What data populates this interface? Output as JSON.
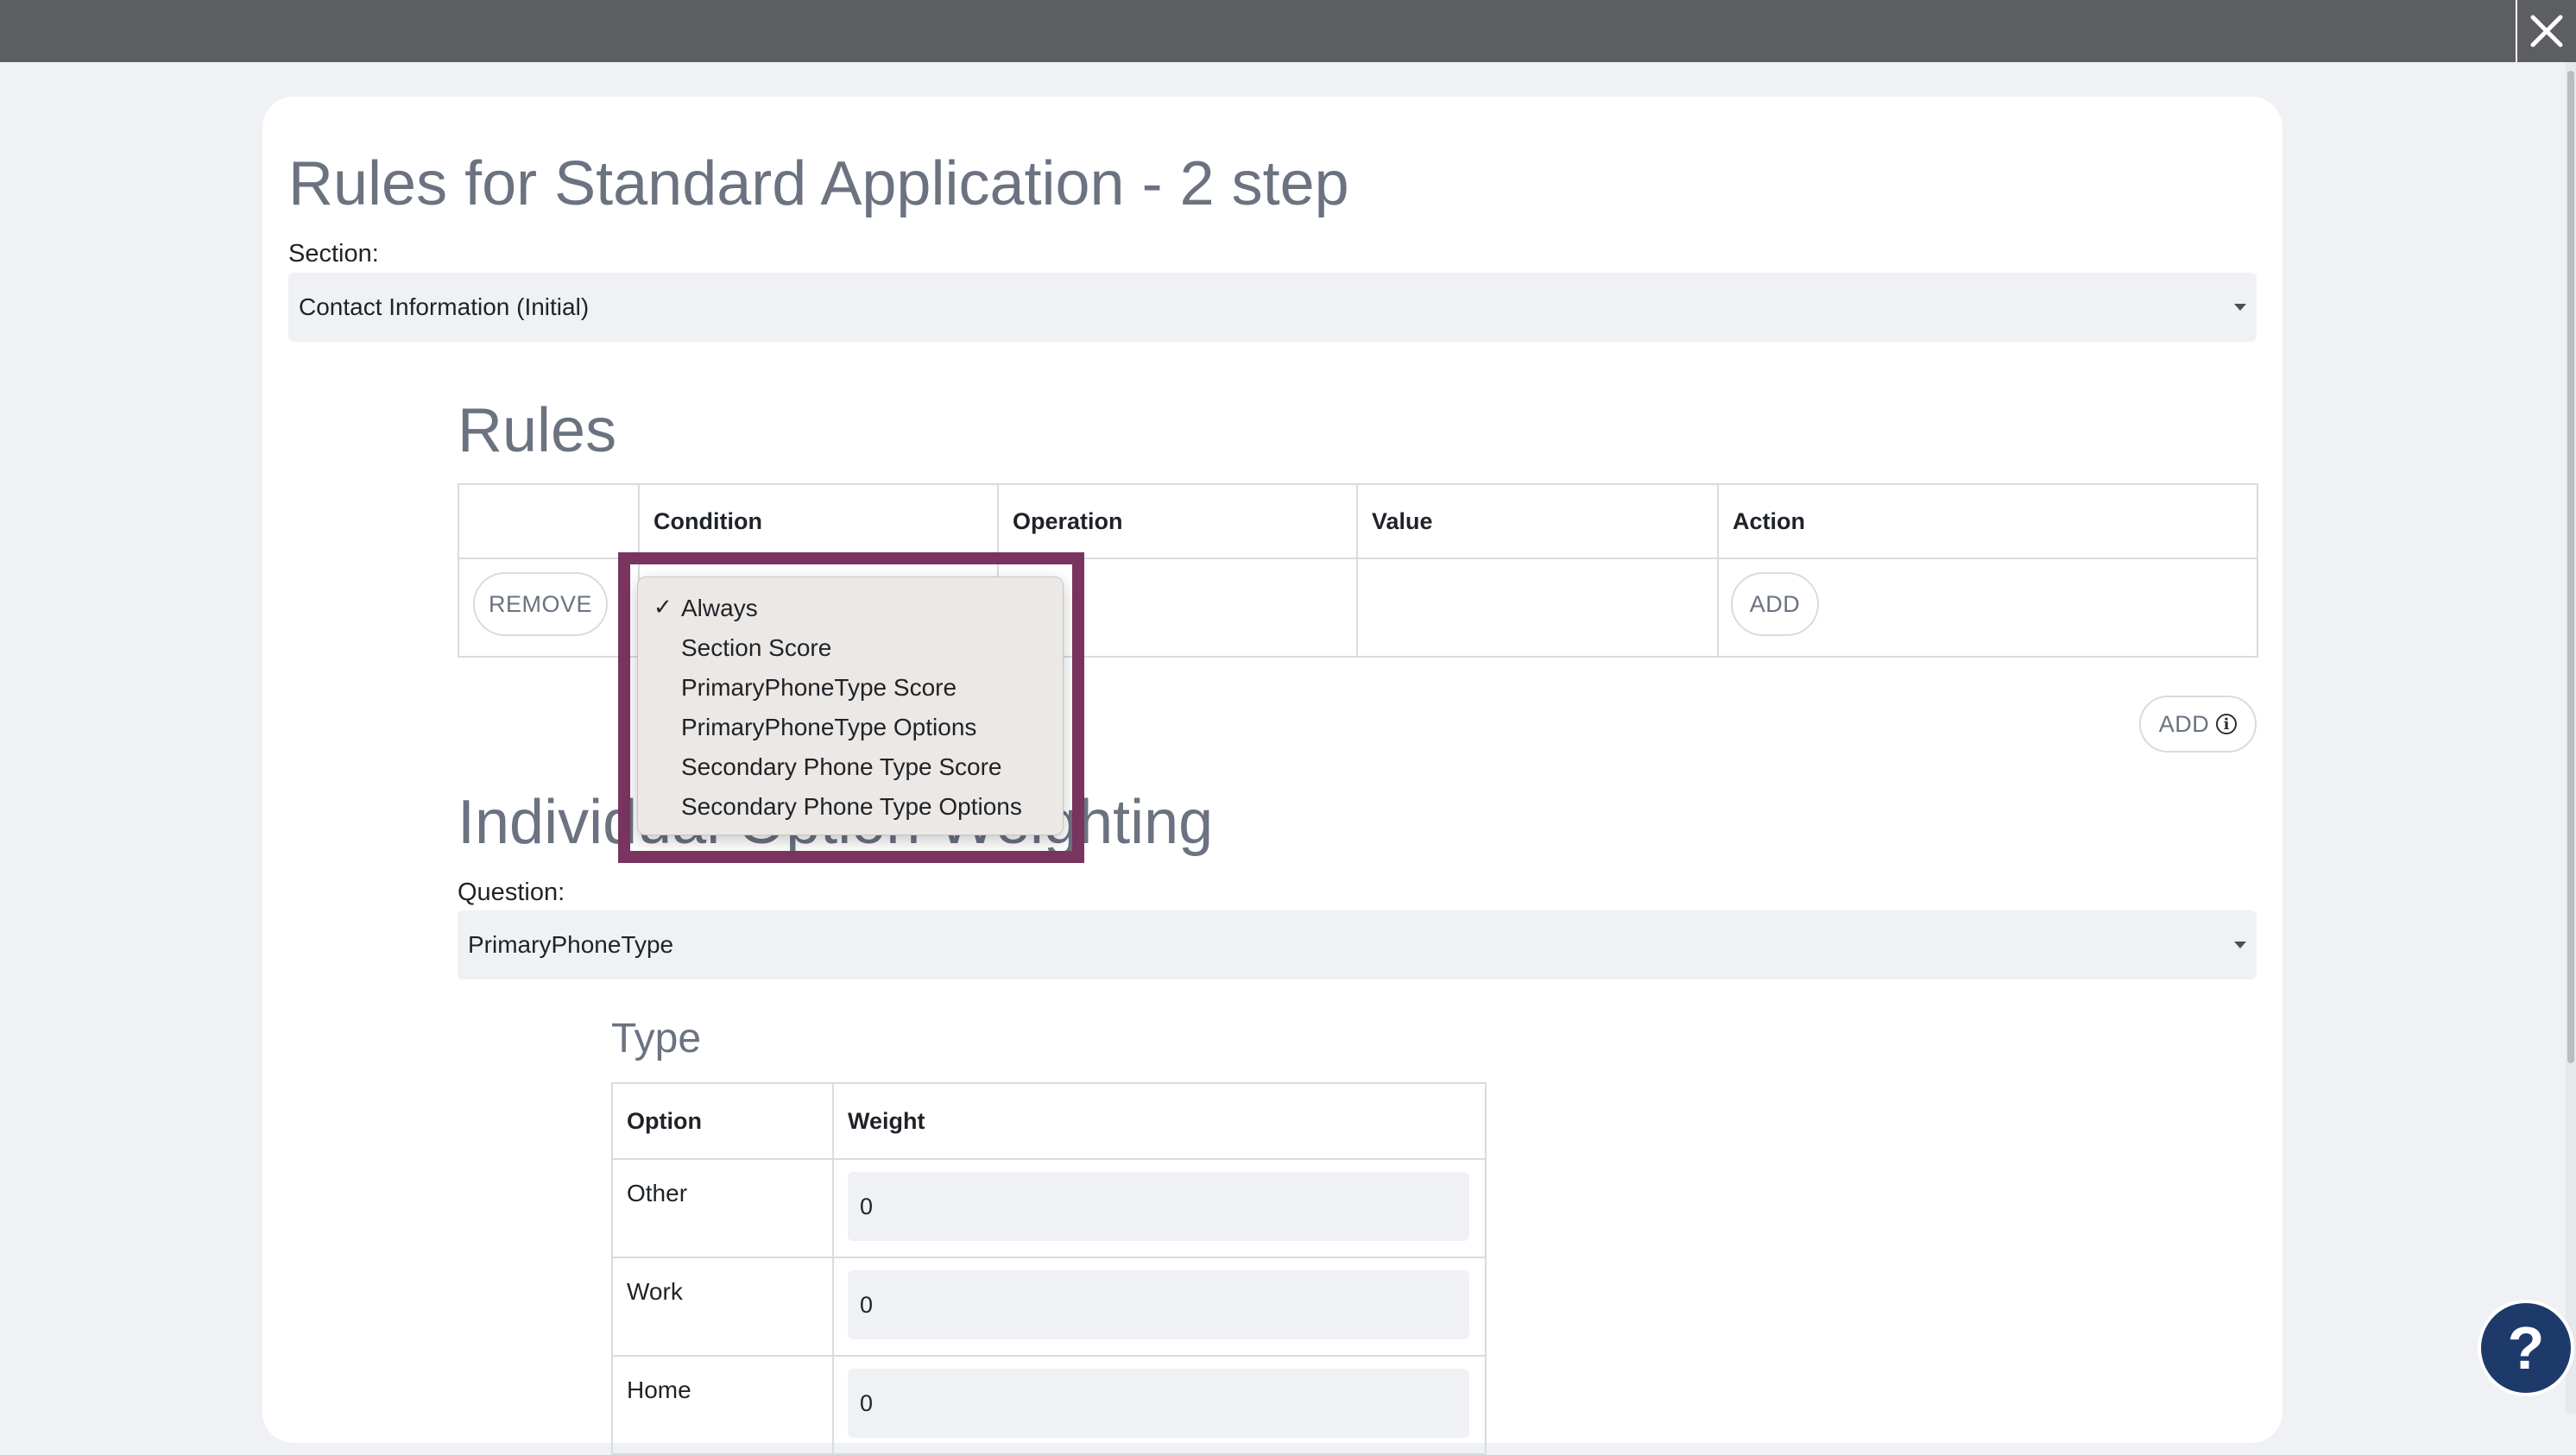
{
  "page": {
    "title": "Rules for Standard Application - 2 step",
    "section_label": "Section:",
    "section_value": "Contact Information (Initial)"
  },
  "rules": {
    "heading": "Rules",
    "columns": [
      "",
      "Condition",
      "Operation",
      "Value",
      "Action"
    ],
    "row": {
      "remove_label": "REMOVE",
      "add_label": "ADD"
    },
    "add_rule_label": "ADD",
    "add_rule_icon": "info-icon"
  },
  "condition_dropdown": {
    "selected": "Always",
    "options": [
      "Always",
      "Section Score",
      "PrimaryPhoneType Score",
      "PrimaryPhoneType Options",
      "Secondary Phone Type Score",
      "Secondary Phone Type Options"
    ],
    "highlight_color": "#7a3460"
  },
  "weighting": {
    "heading": "Individual Option Weighting",
    "question_label": "Question:",
    "question_value": "PrimaryPhoneType",
    "type_heading": "Type",
    "columns": [
      "Option",
      "Weight"
    ],
    "rows": [
      {
        "option": "Other",
        "weight": "0"
      },
      {
        "option": "Work",
        "weight": "0"
      },
      {
        "option": "Home",
        "weight": "0"
      }
    ]
  },
  "help": {
    "label": "?",
    "color": "#1e3a6b"
  },
  "topbar": {
    "close_icon": "close-icon",
    "color": "#5c5e62"
  }
}
